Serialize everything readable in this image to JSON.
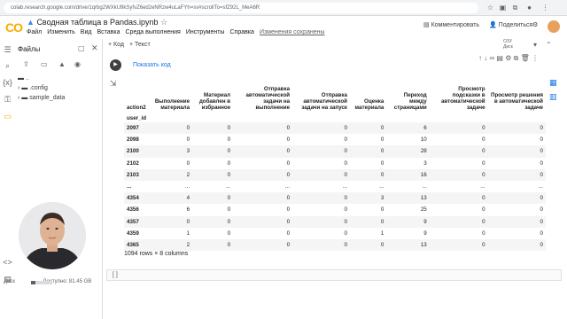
{
  "browser": {
    "url": "colab.research.google.com/drive/1qrbg2WXkU9kSyfvZ6ed2eNRzw4uLaFYh=sv#scrollTo=sfZ92L_MeA6R"
  },
  "header": {
    "logo": "CO",
    "title": "Сводная таблица в Pandas.ipynb",
    "menu": [
      "Файл",
      "Изменить",
      "Вид",
      "Вставка",
      "Среда выполнения",
      "Инструменты",
      "Справка"
    ],
    "saved_status": "Изменения сохранены",
    "comments": "Комментировать",
    "share": "Поделиться"
  },
  "files_panel": {
    "title": "Файлы",
    "items": [
      {
        "name": ".."
      },
      {
        "name": ".config"
      },
      {
        "name": "sample_data"
      }
    ]
  },
  "cell_toolbar": {
    "add_code": "+ Код",
    "add_text": "+ Текст",
    "ram_label": "ОЗУ",
    "disk_label": "Диск"
  },
  "cell": {
    "show_code": "Показать код",
    "empty_cell": "[ ]"
  },
  "output_table": {
    "columns_name": "action2",
    "index_name": "user_id",
    "columns": [
      "Выполнение материала",
      "Материал добавлен в избранное",
      "Отправка автоматической задачи на выполнение",
      "Отправка автоматической задачи на запуск",
      "Оценка материала",
      "Переход между страницами",
      "Просмотр подсказки в автоматической задаче",
      "Просмотр решения в автоматической задаче"
    ],
    "rows": [
      {
        "id": "2097",
        "vals": [
          "0",
          "0",
          "0",
          "0",
          "0",
          "6",
          "0",
          "0"
        ]
      },
      {
        "id": "2098",
        "vals": [
          "0",
          "0",
          "0",
          "0",
          "0",
          "10",
          "0",
          "0"
        ]
      },
      {
        "id": "2100",
        "vals": [
          "3",
          "0",
          "0",
          "0",
          "0",
          "28",
          "0",
          "0"
        ]
      },
      {
        "id": "2102",
        "vals": [
          "0",
          "0",
          "0",
          "0",
          "0",
          "3",
          "0",
          "0"
        ]
      },
      {
        "id": "2103",
        "vals": [
          "2",
          "0",
          "0",
          "0",
          "0",
          "16",
          "0",
          "0"
        ]
      },
      {
        "id": "...",
        "vals": [
          "...",
          "...",
          "...",
          "...",
          "...",
          "...",
          "...",
          "..."
        ]
      },
      {
        "id": "4354",
        "vals": [
          "4",
          "0",
          "0",
          "0",
          "3",
          "13",
          "0",
          "0"
        ]
      },
      {
        "id": "4356",
        "vals": [
          "6",
          "0",
          "0",
          "0",
          "0",
          "25",
          "0",
          "0"
        ]
      },
      {
        "id": "4357",
        "vals": [
          "0",
          "0",
          "0",
          "0",
          "0",
          "9",
          "0",
          "0"
        ]
      },
      {
        "id": "4359",
        "vals": [
          "1",
          "0",
          "0",
          "0",
          "1",
          "9",
          "0",
          "0"
        ]
      },
      {
        "id": "4365",
        "vals": [
          "2",
          "0",
          "0",
          "0",
          "0",
          "13",
          "0",
          "0"
        ]
      }
    ],
    "shape_info": "1094 rows × 8 columns"
  },
  "status": {
    "disk_label": "Диск",
    "disk_free": "Доступно: 81.45 GB"
  }
}
